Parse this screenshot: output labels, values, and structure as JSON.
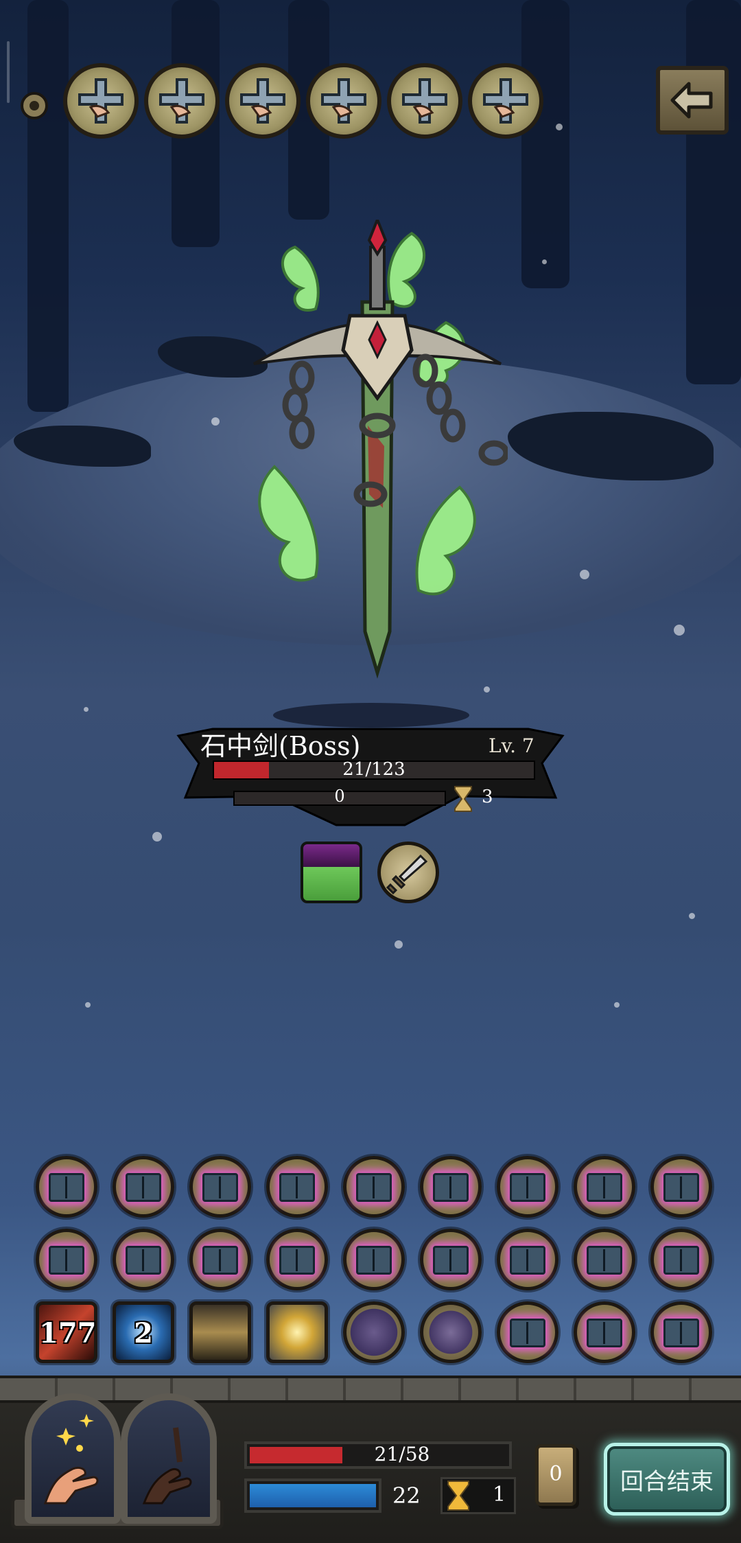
{
  "top_bar": {
    "buff_icon": "cross-shield-icon",
    "buff_count": 6,
    "back_icon": "arrow-left-icon"
  },
  "boss": {
    "name": "石中剑(Boss)",
    "level": "Lv. 7",
    "hp_text": "21/123",
    "hp_current": 21,
    "hp_max": 123,
    "shield_text": "0",
    "countdown_text": "3",
    "intents": [
      "cursed-sword-intent-icon",
      "attack-sword-intent-icon"
    ]
  },
  "cards": {
    "row1": [
      "spellbook-icon",
      "spellbook-icon",
      "spellbook-icon",
      "spellbook-icon",
      "spellbook-icon",
      "spellbook-icon",
      "spellbook-icon",
      "spellbook-icon",
      "spellbook-icon"
    ],
    "row2": [
      "spellbook-icon",
      "spellbook-icon",
      "spellbook-icon",
      "spellbook-icon",
      "spellbook-icon",
      "spellbook-icon",
      "spellbook-icon",
      "spellbook-icon",
      "spellbook-icon"
    ],
    "row3": [
      {
        "icon": "strike-icon",
        "count": "177"
      },
      {
        "icon": "frost-icon",
        "count": "2"
      },
      {
        "icon": "monk-icon",
        "count": ""
      },
      {
        "icon": "golden-figure-icon",
        "count": ""
      },
      {
        "icon": "dark-tome-icon",
        "count": ""
      },
      {
        "icon": "bat-icon",
        "count": ""
      },
      {
        "icon": "spellbook-icon",
        "count": ""
      },
      {
        "icon": "spellbook-icon",
        "count": ""
      },
      {
        "icon": "spellbook-icon",
        "count": ""
      }
    ]
  },
  "player": {
    "hp_text": "21/58",
    "hp_current": 21,
    "hp_max": 58,
    "mana_text": "22",
    "turns_text": "1",
    "deck_count": "0"
  },
  "end_turn_label": "回合结束",
  "colors": {
    "hp_red": "#c62a2f",
    "mana_blue": "#2c8bd8",
    "book_glow": "#e05ac8",
    "end_button": "#4f8b82"
  }
}
